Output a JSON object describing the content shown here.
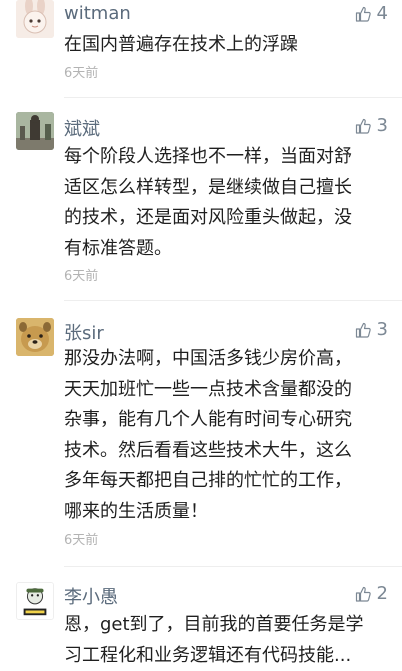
{
  "comments": [
    {
      "user": "witman",
      "likes": "4",
      "lines": [
        "在国内普遍存在技术上的浮躁"
      ],
      "time": "6天前",
      "avatar": "cartoon-rabbit-avatar"
    },
    {
      "user": "斌斌",
      "likes": "3",
      "lines": [
        "每个阶段人选择也不一样，当面对舒",
        "适区怎么样转型，是继续做自己擅长",
        "的技术，还是面对风险重头做起，没",
        "有标准答题。"
      ],
      "time": "6天前",
      "avatar": "statue-photo-avatar"
    },
    {
      "user": "张sir",
      "likes": "3",
      "lines": [
        "那没办法啊，中国活多钱少房价高，",
        "天天加班忙一些一点技术含量都没的",
        "杂事，能有几个人能有时间专心研究",
        "技术。然后看看这些技术大牛，这么",
        "多年每天都把自己排的忙忙的工作，",
        "哪来的生活质量！"
      ],
      "time": "6天前",
      "avatar": "dog-face-avatar"
    },
    {
      "user": "李小愚",
      "likes": "2",
      "lines": [
        "恩，get到了，目前我的首要任务是学",
        "习工程化和业务逻辑还有代码技能..."
      ],
      "time": "",
      "avatar": "cartoon-sticker-avatar"
    }
  ],
  "colors": {
    "name": "#5b6b7c",
    "time": "#b3b3b3",
    "like": "#7c8894"
  }
}
